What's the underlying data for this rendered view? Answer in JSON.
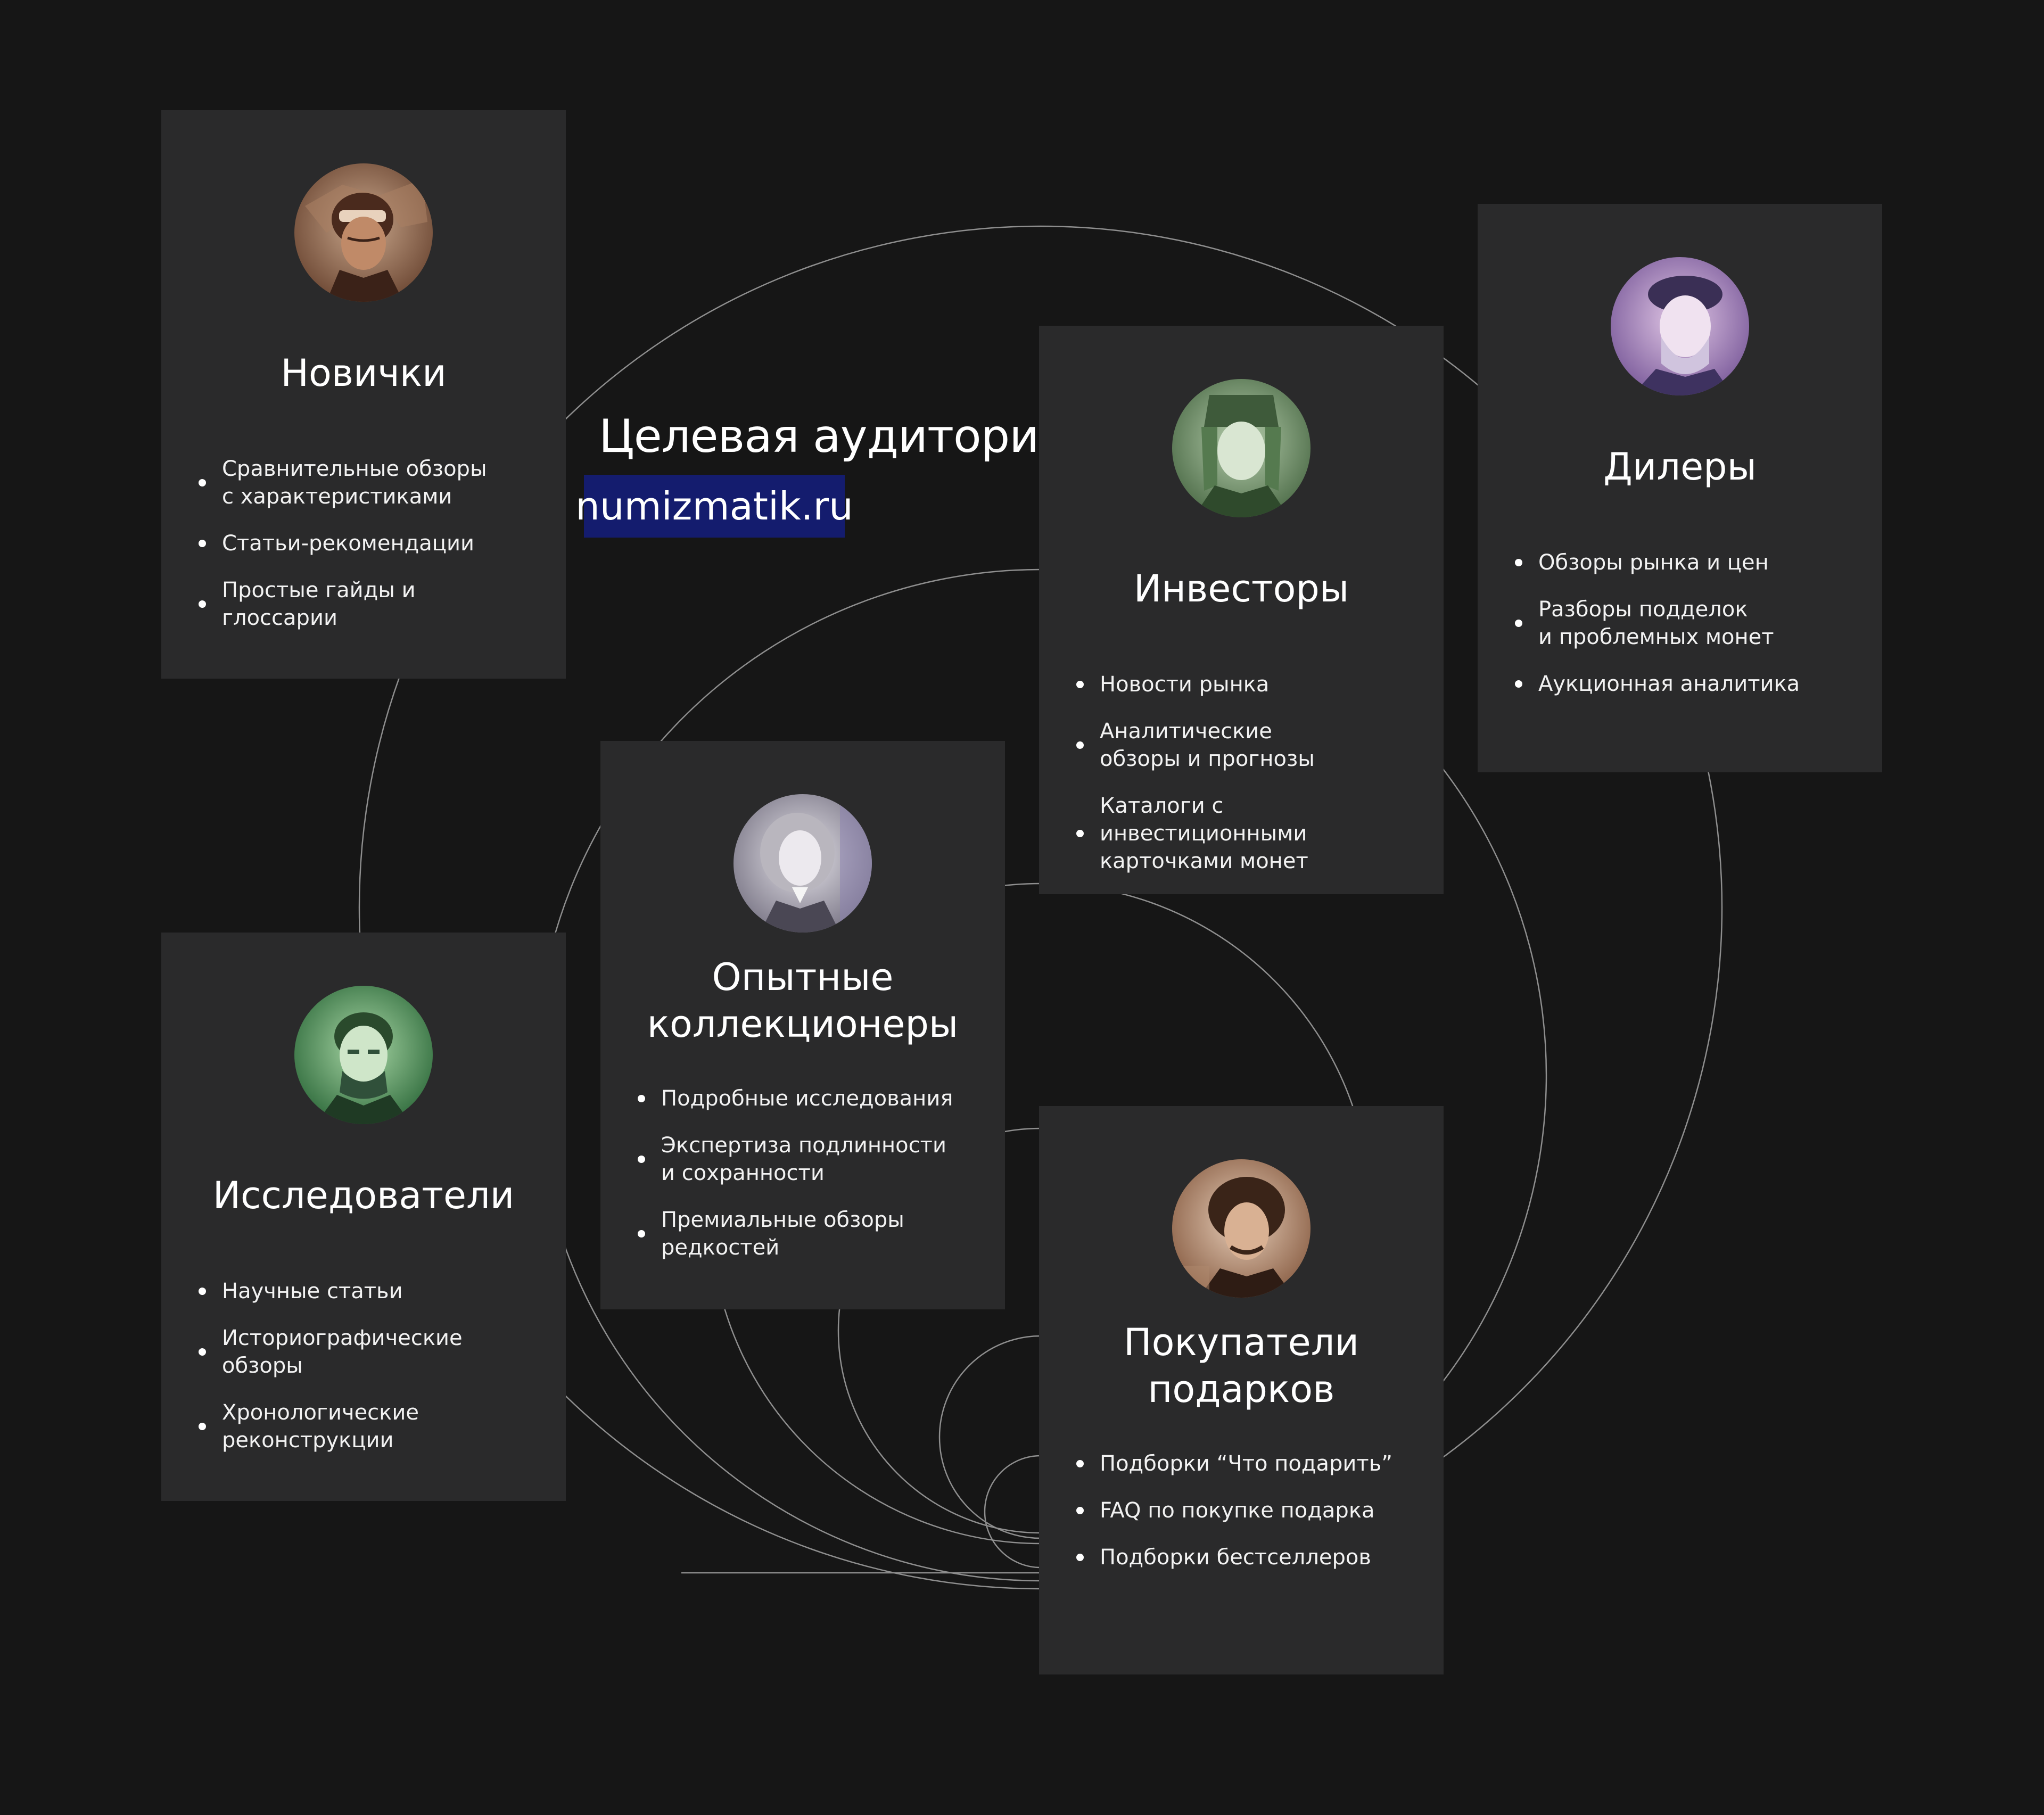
{
  "heading": "Целевая аудитория",
  "brand": "numizmatik.ru",
  "colors": {
    "background": "#161616",
    "card": "#2a2a2b",
    "brand_badge": "#141c6e",
    "guide_lines": "#8e8e8e",
    "text": "#ffffff"
  },
  "cards": [
    {
      "title": "Новички",
      "portrait_icon": "portrait-aviator-banknote-icon",
      "items": [
        "Сравнительные обзоры\nс характеристиками",
        "Статьи-рекомендации",
        "Простые гайды и глоссарии"
      ]
    },
    {
      "title": "Исследователи",
      "portrait_icon": "portrait-scholar-green-banknote-icon",
      "items": [
        "Научные статьи",
        "Историографические\nобзоры",
        "Хронологические\nреконструкции"
      ]
    },
    {
      "title": "Опытные\nколлекционеры",
      "portrait_icon": "portrait-wigged-gentleman-banknote-icon",
      "items": [
        "Подробные исследования",
        "Экспертиза подлинности\nи сохранности",
        "Премиальные обзоры\nредкостей"
      ]
    },
    {
      "title": "Инвесторы",
      "portrait_icon": "portrait-knight-green-banknote-icon",
      "items": [
        "Новости рынка",
        "Аналитические\nобзоры и прогнозы",
        "Каталоги с инвестиционными\nкарточками монет"
      ]
    },
    {
      "title": "Дилеры",
      "portrait_icon": "portrait-elder-purple-banknote-icon",
      "items": [
        "Обзоры рынка и цен",
        "Разборы подделок\nи проблемных монет",
        "Аукционная аналитика"
      ]
    },
    {
      "title": "Покупатели\nподарков",
      "portrait_icon": "portrait-romantic-poet-banknote-icon",
      "items": [
        "Подборки “Что подарить”",
        "FAQ по покупке подарка",
        "Подборки бестселлеров"
      ]
    }
  ]
}
